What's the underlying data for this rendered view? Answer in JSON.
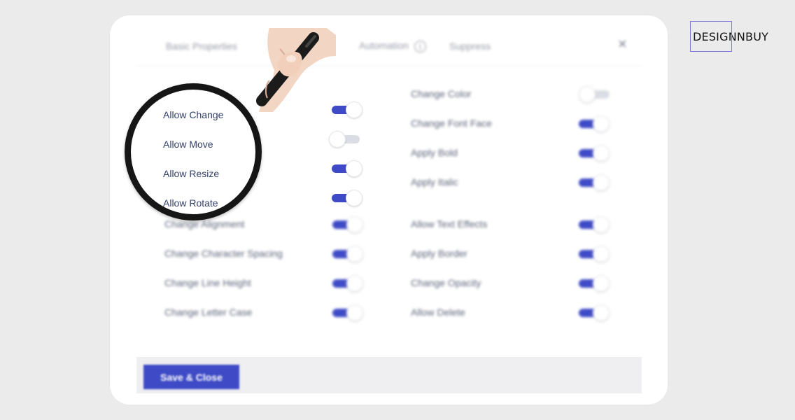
{
  "brand": {
    "name": "DESIGNNBUY"
  },
  "tabs": [
    {
      "label": "Basic Properties"
    },
    {
      "label": "Automation"
    },
    {
      "label": "Suppress"
    }
  ],
  "close_icon": "×",
  "info_icon": "i",
  "magnified": [
    {
      "label": "Allow Change",
      "on": true
    },
    {
      "label": "Allow Move",
      "on": false
    },
    {
      "label": "Allow Resize",
      "on": true
    },
    {
      "label": "Allow Rotate",
      "on": true
    }
  ],
  "left_rows": [
    {
      "label": "Change Alignment",
      "on": true
    },
    {
      "label": "Change Character Spacing",
      "on": true
    },
    {
      "label": "Change Line Height",
      "on": true
    },
    {
      "label": "Change Letter Case",
      "on": true
    }
  ],
  "right_rows": [
    {
      "label": "Change Color",
      "on": false
    },
    {
      "label": "Change Font Face",
      "on": true
    },
    {
      "label": "Apply Bold",
      "on": true
    },
    {
      "label": "Apply Italic",
      "on": true
    },
    {
      "label": "Allow Text Effects",
      "on": true
    },
    {
      "label": "Apply Border",
      "on": true
    },
    {
      "label": "Change Opacity",
      "on": true
    },
    {
      "label": "Allow Delete",
      "on": true
    }
  ],
  "footer": {
    "save_label": "Save & Close"
  },
  "colors": {
    "accent": "#3f4bc6",
    "brand_box": "#7f77d9",
    "background": "#ebebeb"
  }
}
